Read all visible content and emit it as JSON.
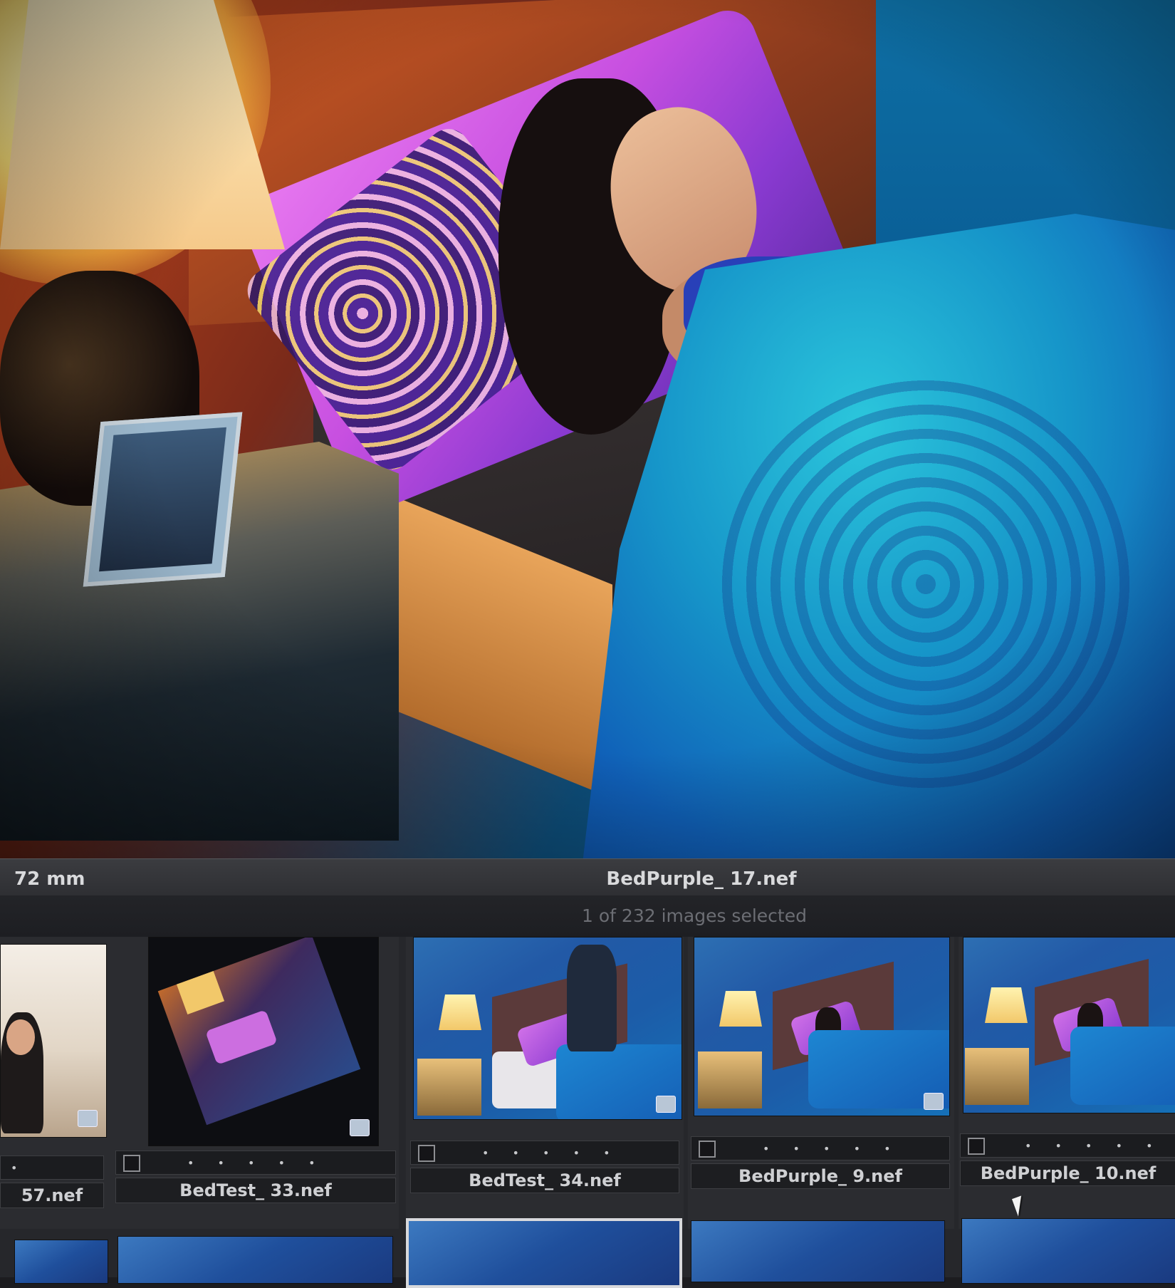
{
  "viewer": {
    "focal_length": "72 mm",
    "filename": "BedPurple_ 17.nef",
    "selection_status": "1 of 232 images selected"
  },
  "filmstrip": {
    "items": [
      {
        "name": "57.nef",
        "rating_dots": "•",
        "selected": false
      },
      {
        "name": "BedTest_ 33.nef",
        "rating_dots": "• • • • •",
        "selected": false
      },
      {
        "name": "BedTest_ 34.nef",
        "rating_dots": "• • • • •",
        "selected": false
      },
      {
        "name": "BedPurple_ 9.nef",
        "rating_dots": "• • • • •",
        "selected": false
      },
      {
        "name": "BedPurple_ 10.nef",
        "rating_dots": "• • • • •",
        "selected": false
      }
    ],
    "second_row_selected_index": 2
  },
  "colors": {
    "panel_bg": "#26272b",
    "info_text": "#d9dadc",
    "status_text": "#6c6e74",
    "selection_border": "#d8d9dc"
  }
}
